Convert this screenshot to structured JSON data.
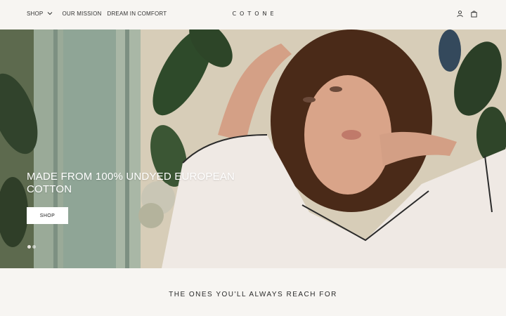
{
  "header": {
    "nav": [
      {
        "label": "SHOP"
      },
      {
        "label": "OUR MISSION"
      },
      {
        "label": "DREAM IN COMFORT"
      }
    ],
    "logo": "COTONE",
    "icons": [
      "account-icon",
      "bag-icon"
    ]
  },
  "hero": {
    "title": "MADE FROM 100% UNDYED EUROPEAN COTTON",
    "button_label": "SHOP",
    "slides": 2,
    "active_slide": 1
  },
  "section": {
    "title": "THE ONES YOU'LL ALWAYS REACH FOR"
  },
  "colors": {
    "page_bg": "#f7f5f2",
    "text": "#2a2a2a",
    "button_bg": "#ffffff"
  }
}
